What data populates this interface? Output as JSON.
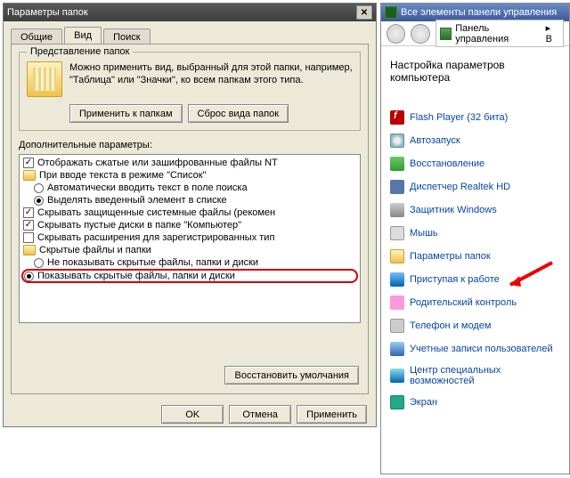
{
  "dialog": {
    "title": "Параметры папок",
    "tabs": {
      "general": "Общие",
      "view": "Вид",
      "search": "Поиск"
    },
    "viewpane": {
      "group_legend": "Представление папок",
      "group_text": "Можно применить вид, выбранный для этой папки, например, \"Таблица\" или \"Значки\", ко всем папкам этого типа.",
      "apply_folders": "Применить к папкам",
      "reset_folders": "Сброс вида папок",
      "adv_label": "Дополнительные параметры:",
      "tree": {
        "r1": "Отображать сжатые или зашифрованные файлы NT",
        "r2": "При вводе текста в режиме \"Список\"",
        "r2a": "Автоматически вводить текст в поле поиска",
        "r2b": "Выделять введенный элемент в списке",
        "r3": "Скрывать защищенные системные файлы (рекомен",
        "r4": "Скрывать пустые диски в папке \"Компьютер\"",
        "r5": "Скрывать расширения для зарегистрированных тип",
        "r6": "Скрытые файлы и папки",
        "r6a": "Не показывать скрытые файлы, папки и диски",
        "r6b": "Показывать скрытые файлы, папки и диски"
      },
      "restore_defaults": "Восстановить умолчания"
    },
    "buttons": {
      "ok": "OK",
      "cancel": "Отмена",
      "apply": "Применить"
    }
  },
  "cp": {
    "title": "Все элементы панели управления",
    "addr": "Панель управления",
    "addr_suffix": "▸ В",
    "heading": "Настройка параметров компьютера",
    "items": {
      "flash": "Flash Player (32 бита)",
      "autorun": "Автозапуск",
      "restore": "Восстановление",
      "realtek": "Диспетчер Realtek HD",
      "defender": "Защитник Windows",
      "mouse": "Мышь",
      "folders": "Параметры папок",
      "start": "Приступая к работе",
      "parent": "Родительский контроль",
      "phone": "Телефон и модем",
      "users": "Учетные записи пользователей",
      "access": "Центр специальных возможностей",
      "screen": "Экран"
    }
  }
}
